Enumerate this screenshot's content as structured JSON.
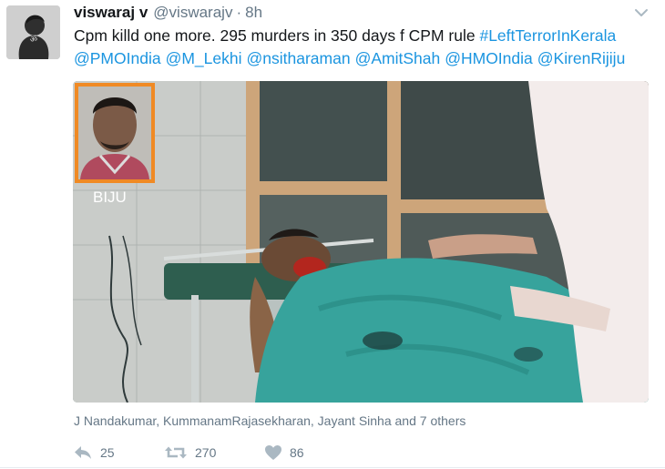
{
  "tweet": {
    "display_name": "viswaraj v",
    "handle": "@viswarajv",
    "separator": "·",
    "timestamp": "8h",
    "text_plain": "Cpm killd one more. 295 murders in 350 days f CPM rule ",
    "hashtag": "#LeftTerrorInKerala",
    "mentions": [
      "@PMOIndia",
      "@M_Lekhi",
      "@nsitharaman",
      "@AmitShah",
      "@HMOIndia",
      "@KirenRijiju"
    ],
    "media": {
      "inset_caption": "BIJU"
    },
    "liked_by": "J Nandakumar, KummanamRajasekharan, Jayant Sinha and 7 others",
    "actions": {
      "reply": {
        "icon": "reply-icon",
        "count": "25"
      },
      "retweet": {
        "icon": "retweet-icon",
        "count": "270"
      },
      "like": {
        "icon": "heart-icon",
        "count": "86"
      }
    },
    "colors": {
      "link": "#1b95e0",
      "meta": "#657786",
      "icon": "#aab8c2",
      "inset_border": "#f08a24"
    }
  }
}
